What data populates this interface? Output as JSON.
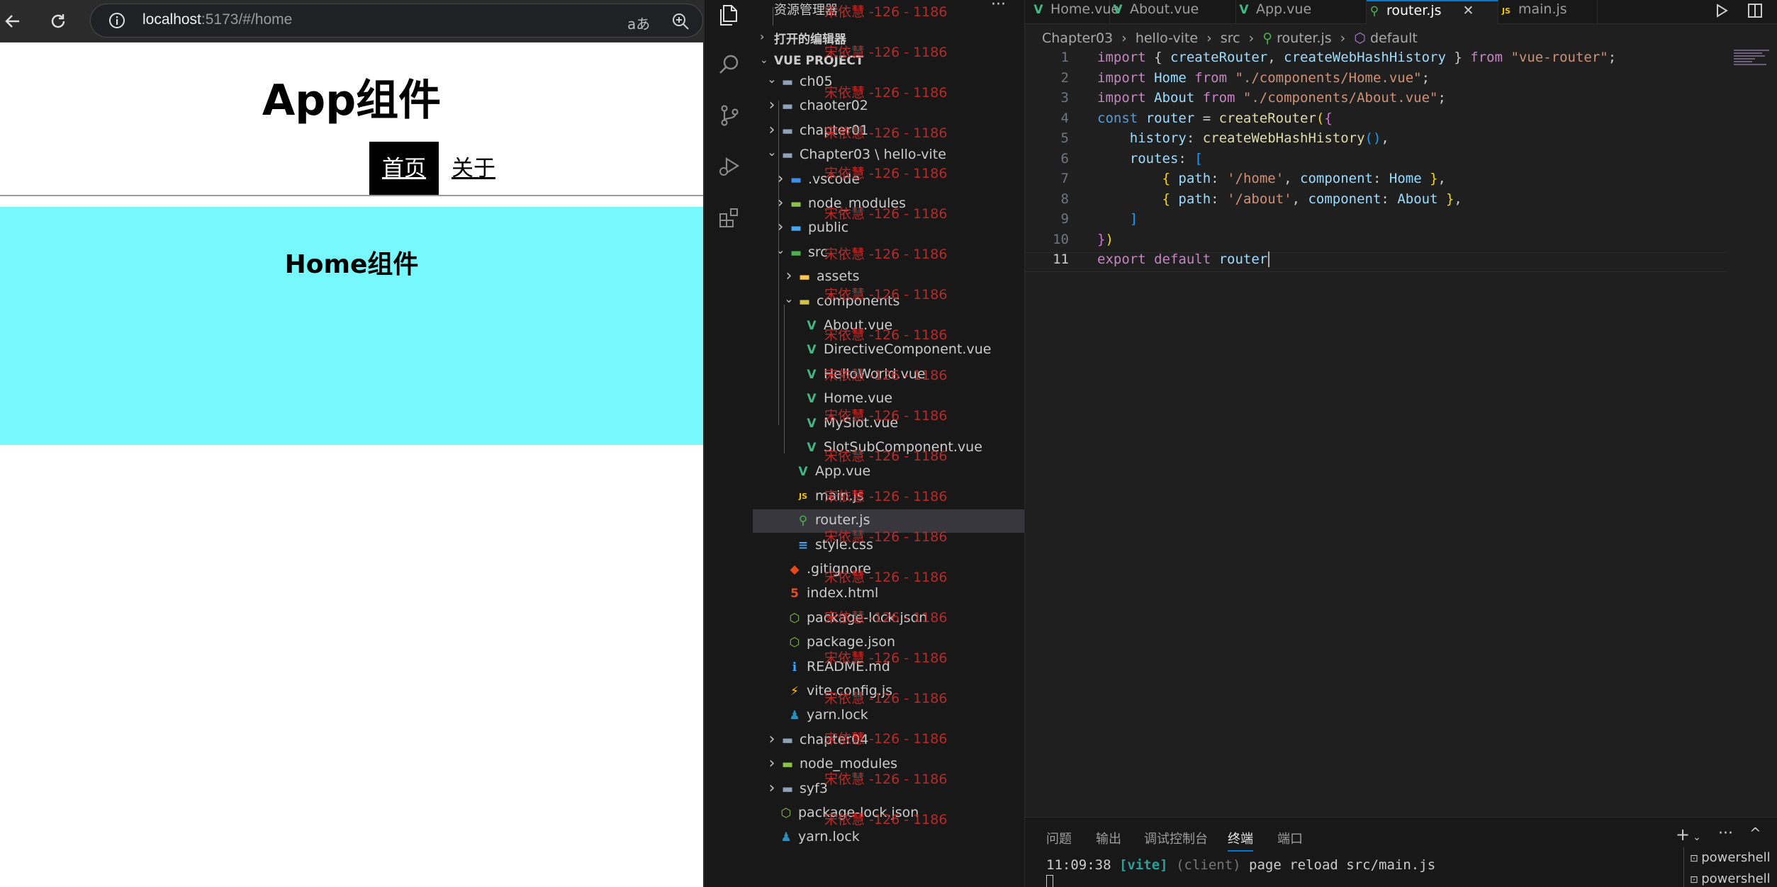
{
  "browser": {
    "url_host": "localhost",
    "url_rest": ":5173/#/home",
    "app_title": "App组件",
    "nav": [
      "首页",
      "关于"
    ],
    "home_title": "Home组件"
  },
  "explorer": {
    "title": "资源管理器",
    "open_editors": "打开的编辑器",
    "project": "VUE PROJECT",
    "items": [
      {
        "label": "ch05",
        "depth": 1,
        "kind": "folder",
        "open": true
      },
      {
        "label": "chaoter02",
        "depth": 1,
        "kind": "folder",
        "open": false
      },
      {
        "label": "chapter01",
        "depth": 1,
        "kind": "folder",
        "open": false
      },
      {
        "label": "Chapter03 \\ hello-vite",
        "depth": 1,
        "kind": "folder",
        "open": true
      },
      {
        "label": ".vscode",
        "depth": 2,
        "kind": "vscode",
        "open": false
      },
      {
        "label": "node_modules",
        "depth": 2,
        "kind": "node",
        "open": false
      },
      {
        "label": "public",
        "depth": 2,
        "kind": "public",
        "open": false
      },
      {
        "label": "src",
        "depth": 2,
        "kind": "src",
        "open": true
      },
      {
        "label": "assets",
        "depth": 3,
        "kind": "assets",
        "open": false
      },
      {
        "label": "components",
        "depth": 3,
        "kind": "components",
        "open": true
      },
      {
        "label": "About.vue",
        "depth": 4,
        "kind": "vue"
      },
      {
        "label": "DirectiveComponent.vue",
        "depth": 4,
        "kind": "vue"
      },
      {
        "label": "HelloWorld.vue",
        "depth": 4,
        "kind": "vue"
      },
      {
        "label": "Home.vue",
        "depth": 4,
        "kind": "vue"
      },
      {
        "label": "MySlot.vue",
        "depth": 4,
        "kind": "vue"
      },
      {
        "label": "SlotSubComponent.vue",
        "depth": 4,
        "kind": "vue"
      },
      {
        "label": "App.vue",
        "depth": 3,
        "kind": "vue"
      },
      {
        "label": "main.js",
        "depth": 3,
        "kind": "js"
      },
      {
        "label": "router.js",
        "depth": 3,
        "kind": "router",
        "selected": true
      },
      {
        "label": "style.css",
        "depth": 3,
        "kind": "css"
      },
      {
        "label": ".gitignore",
        "depth": 2,
        "kind": "git"
      },
      {
        "label": "index.html",
        "depth": 2,
        "kind": "html"
      },
      {
        "label": "package-lock.json",
        "depth": 2,
        "kind": "pkg"
      },
      {
        "label": "package.json",
        "depth": 2,
        "kind": "pkg"
      },
      {
        "label": "README.md",
        "depth": 2,
        "kind": "info"
      },
      {
        "label": "vite.config.js",
        "depth": 2,
        "kind": "vite"
      },
      {
        "label": "yarn.lock",
        "depth": 2,
        "kind": "yarn"
      },
      {
        "label": "chapter04",
        "depth": 1,
        "kind": "folder",
        "open": false
      },
      {
        "label": "node_modules",
        "depth": 1,
        "kind": "node",
        "open": false
      },
      {
        "label": "syf3",
        "depth": 1,
        "kind": "folder",
        "open": false
      },
      {
        "label": "package-lock.json",
        "depth": 1,
        "kind": "pkg"
      },
      {
        "label": "yarn.lock",
        "depth": 1,
        "kind": "yarn"
      }
    ]
  },
  "watermark": "宋依慧 -126 - 1186",
  "tabs": [
    {
      "label": "Home.vue",
      "kind": "vue"
    },
    {
      "label": "About.vue",
      "kind": "vue"
    },
    {
      "label": "App.vue",
      "kind": "vue"
    },
    {
      "label": "router.js",
      "kind": "router",
      "active": true
    },
    {
      "label": "main.js",
      "kind": "js"
    }
  ],
  "breadcrumb": {
    "parts": [
      "Chapter03",
      "hello-vite",
      "src",
      "router.js",
      "default"
    ]
  },
  "code": {
    "current_line": 11,
    "lines": [
      [
        [
          "kw",
          "import "
        ],
        [
          "",
          "{ "
        ],
        [
          "vr",
          "createRouter"
        ],
        [
          "",
          ", "
        ],
        [
          "vr",
          "createWebHashHistory"
        ],
        [
          "",
          " } "
        ],
        [
          "kw",
          "from "
        ],
        [
          "st",
          "\"vue-router\""
        ],
        [
          "",
          ";"
        ]
      ],
      [
        [
          "kw",
          "import "
        ],
        [
          "vr",
          "Home "
        ],
        [
          "kw",
          "from "
        ],
        [
          "st",
          "\"./components/Home.vue\""
        ],
        [
          "",
          ";"
        ]
      ],
      [
        [
          "kw",
          "import "
        ],
        [
          "vr",
          "About "
        ],
        [
          "kw",
          "from "
        ],
        [
          "st",
          "\"./components/About.vue\""
        ],
        [
          "",
          ";"
        ]
      ],
      [
        [
          "kb",
          "const "
        ],
        [
          "vr",
          "router "
        ],
        [
          "",
          "= "
        ],
        [
          "fn",
          "createRouter"
        ],
        [
          "bk",
          "("
        ],
        [
          "bk2",
          "{"
        ]
      ],
      [
        [
          "",
          "    "
        ],
        [
          "vr",
          "history"
        ],
        [
          "",
          ": "
        ],
        [
          "fn",
          "createWebHashHistory"
        ],
        [
          "bk3",
          "()"
        ],
        [
          "",
          ","
        ]
      ],
      [
        [
          "",
          "    "
        ],
        [
          "vr",
          "routes"
        ],
        [
          "",
          ": "
        ],
        [
          "bk3",
          "["
        ]
      ],
      [
        [
          "",
          "        "
        ],
        [
          "bk",
          "{ "
        ],
        [
          "vr",
          "path"
        ],
        [
          "",
          ": "
        ],
        [
          "st",
          "'/home'"
        ],
        [
          "",
          ", "
        ],
        [
          "vr",
          "component"
        ],
        [
          "",
          ": "
        ],
        [
          "vr",
          "Home "
        ],
        [
          "bk",
          "}"
        ],
        [
          "",
          ","
        ]
      ],
      [
        [
          "",
          "        "
        ],
        [
          "bk",
          "{ "
        ],
        [
          "vr",
          "path"
        ],
        [
          "",
          ": "
        ],
        [
          "st",
          "'/about'"
        ],
        [
          "",
          ", "
        ],
        [
          "vr",
          "component"
        ],
        [
          "",
          ": "
        ],
        [
          "vr",
          "About "
        ],
        [
          "bk",
          "}"
        ],
        [
          "",
          ","
        ]
      ],
      [
        [
          "",
          "    "
        ],
        [
          "bk3",
          "]"
        ]
      ],
      [
        [
          "bk2",
          "}"
        ],
        [
          "bk",
          ")"
        ]
      ],
      [
        [
          "kw",
          "export "
        ],
        [
          "kw",
          "default "
        ],
        [
          "vr",
          "router"
        ]
      ]
    ]
  },
  "panel": {
    "tabs": [
      "问题",
      "输出",
      "调试控制台",
      "终端",
      "端口"
    ],
    "active": "终端",
    "terminal_time": "11:09:38",
    "terminal_tag": "[vite]",
    "terminal_client": "(client)",
    "terminal_msg": "page reload src/main.js",
    "terminals": [
      "powershell",
      "powershell"
    ]
  }
}
